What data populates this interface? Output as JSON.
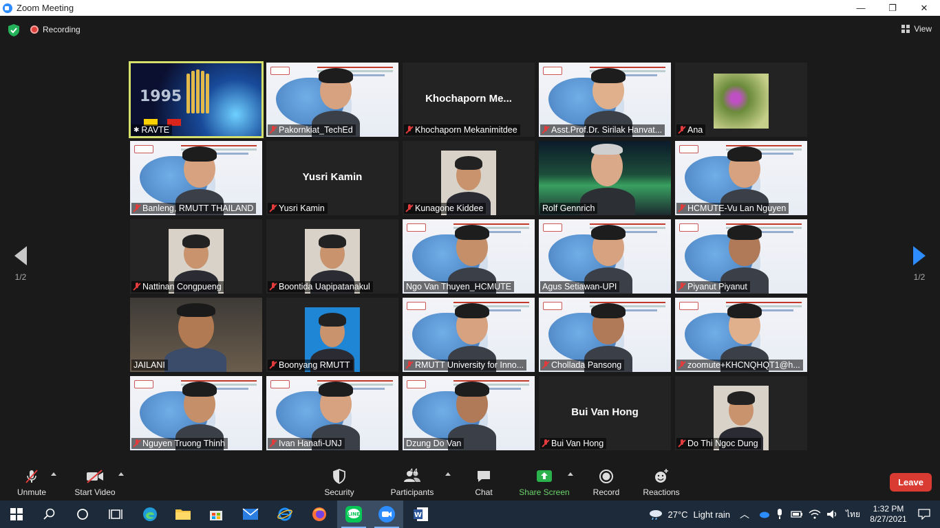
{
  "window": {
    "title": "Zoom Meeting",
    "controls": [
      "—",
      "❐",
      "✕"
    ]
  },
  "topbar": {
    "recording_label": "Recording",
    "view_label": "View"
  },
  "pagination": {
    "left": "1/2",
    "right": "1/2"
  },
  "participants": [
    {
      "name": "RAVTE",
      "muted": false,
      "video": "ravte",
      "active": true
    },
    {
      "name": "Pakornkiat_TechEd",
      "muted": true,
      "video": "slide"
    },
    {
      "name": "Khochaporn Mekanimitdee",
      "muted": true,
      "video": "none",
      "display_name": "Khochaporn  Me..."
    },
    {
      "name": "Asst.Prof.Dr. Sirilak Hanvat...",
      "muted": true,
      "video": "slide"
    },
    {
      "name": "Ana",
      "muted": true,
      "video": "flower"
    },
    {
      "name": "Banleng, RMUTT THAILAND",
      "muted": true,
      "video": "slide"
    },
    {
      "name": "Yusri Kamin",
      "muted": true,
      "video": "none",
      "display_name": "Yusri Kamin"
    },
    {
      "name": "Kunagone Kiddee",
      "muted": true,
      "video": "photo"
    },
    {
      "name": "Rolf Gennrich",
      "muted": false,
      "video": "aurora"
    },
    {
      "name": "HCMUTE-Vu Lan Nguyen",
      "muted": true,
      "video": "slide"
    },
    {
      "name": "Nattinan Congpueng",
      "muted": true,
      "video": "photo"
    },
    {
      "name": "Boontida Uapipatanakul",
      "muted": true,
      "video": "photo"
    },
    {
      "name": "Ngo Van Thuyen_HCMUTE",
      "muted": false,
      "video": "slide"
    },
    {
      "name": "Agus Setiawan-UPI",
      "muted": false,
      "video": "slide"
    },
    {
      "name": "Piyanut Piyanut",
      "muted": true,
      "video": "slide"
    },
    {
      "name": "JAILANI",
      "muted": false,
      "video": "room"
    },
    {
      "name": "Boonyang RMUTT",
      "muted": true,
      "video": "photo-blue"
    },
    {
      "name": "RMUTT University for Inno...",
      "muted": true,
      "video": "slide"
    },
    {
      "name": "Chollada Pansong",
      "muted": true,
      "video": "slide"
    },
    {
      "name": "zoomute+KHCNQHQT1@h...",
      "muted": true,
      "video": "slide"
    },
    {
      "name": "Nguyen Truong Thinh",
      "muted": true,
      "video": "slide"
    },
    {
      "name": "Ivan Hanafi-UNJ",
      "muted": true,
      "video": "slide"
    },
    {
      "name": "Dzung Do Van",
      "muted": false,
      "video": "slide"
    },
    {
      "name": "Bui Van Hong",
      "muted": true,
      "video": "none",
      "display_name": "Bui Van Hong"
    },
    {
      "name": "Do Thi Ngoc Dung",
      "muted": true,
      "video": "photo"
    }
  ],
  "toolbar": {
    "unmute": "Unmute",
    "start_video": "Start Video",
    "security": "Security",
    "participants": "Participants",
    "participants_count": "44",
    "chat": "Chat",
    "share_screen": "Share Screen",
    "record": "Record",
    "reactions": "Reactions",
    "leave": "Leave"
  },
  "taskbar": {
    "weather_temp": "27°C",
    "weather_desc": "Light rain",
    "language": "ไทย",
    "time": "1:32 PM",
    "date": "8/27/2021"
  },
  "colors": {
    "accent_blue": "#2d8cff",
    "leave_red": "#d93b32",
    "share_green": "#6bd36b",
    "active_speaker": "#d5e06b"
  }
}
